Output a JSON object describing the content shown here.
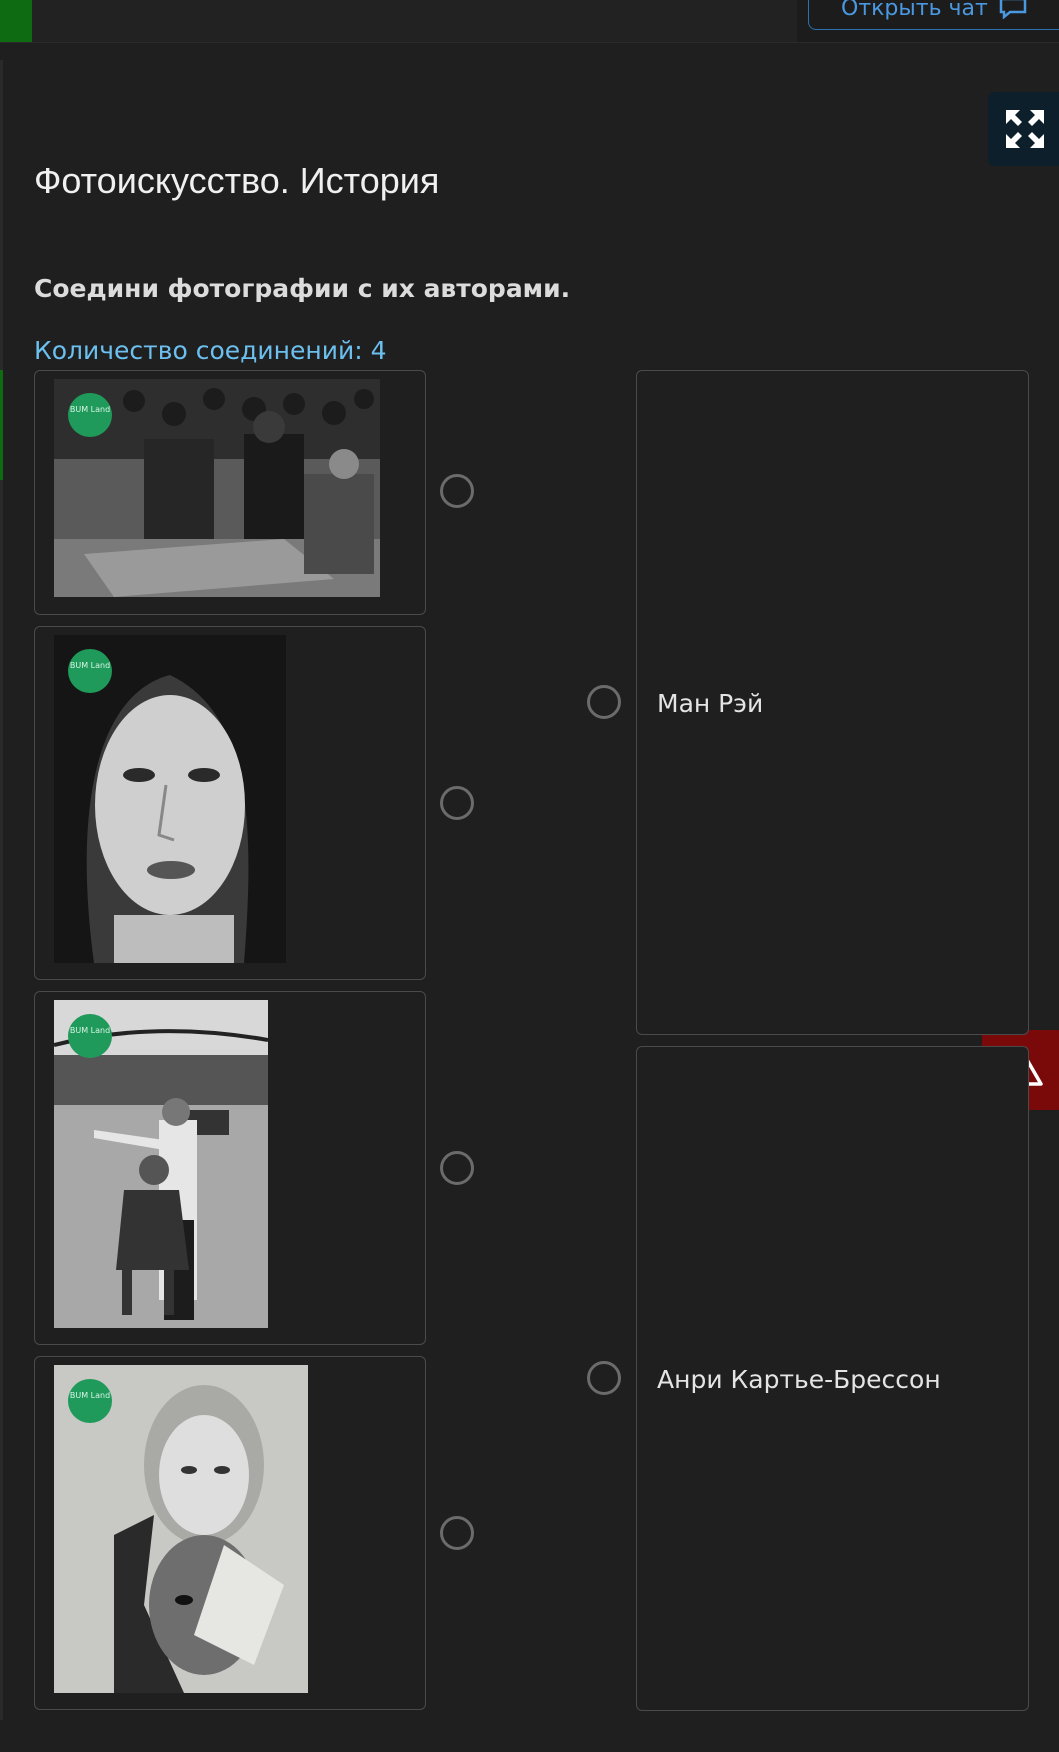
{
  "topbar": {
    "chat_button_label": "Открыть чат"
  },
  "page": {
    "title": "Фотоискусство. История",
    "instruction": "Соедини фотографии с их авторами.",
    "connections_count": "Количество соединений: 4"
  },
  "photos": [
    {
      "icon": "photo-crowd-market",
      "watermark": "BUM Land"
    },
    {
      "icon": "photo-woman-portrait",
      "watermark": "BUM Land"
    },
    {
      "icon": "photo-red-square-soldier-girl",
      "watermark": "BUM Land"
    },
    {
      "icon": "photo-collage-faces",
      "watermark": "BUM Land"
    }
  ],
  "authors": [
    {
      "label": "Ман Рэй"
    },
    {
      "label": "Анри Картье-Брессон"
    }
  ],
  "colors": {
    "background": "#1f1f1f",
    "accent_link": "#6cc0ef",
    "chat_border": "#2e6fb0",
    "warning": "#7a0a0a",
    "expand_bg": "#0c1f2a"
  },
  "icons": {
    "expand": "expand-arrows-icon",
    "warning": "warning-triangle-icon",
    "chat": "chat-bubble-icon"
  }
}
